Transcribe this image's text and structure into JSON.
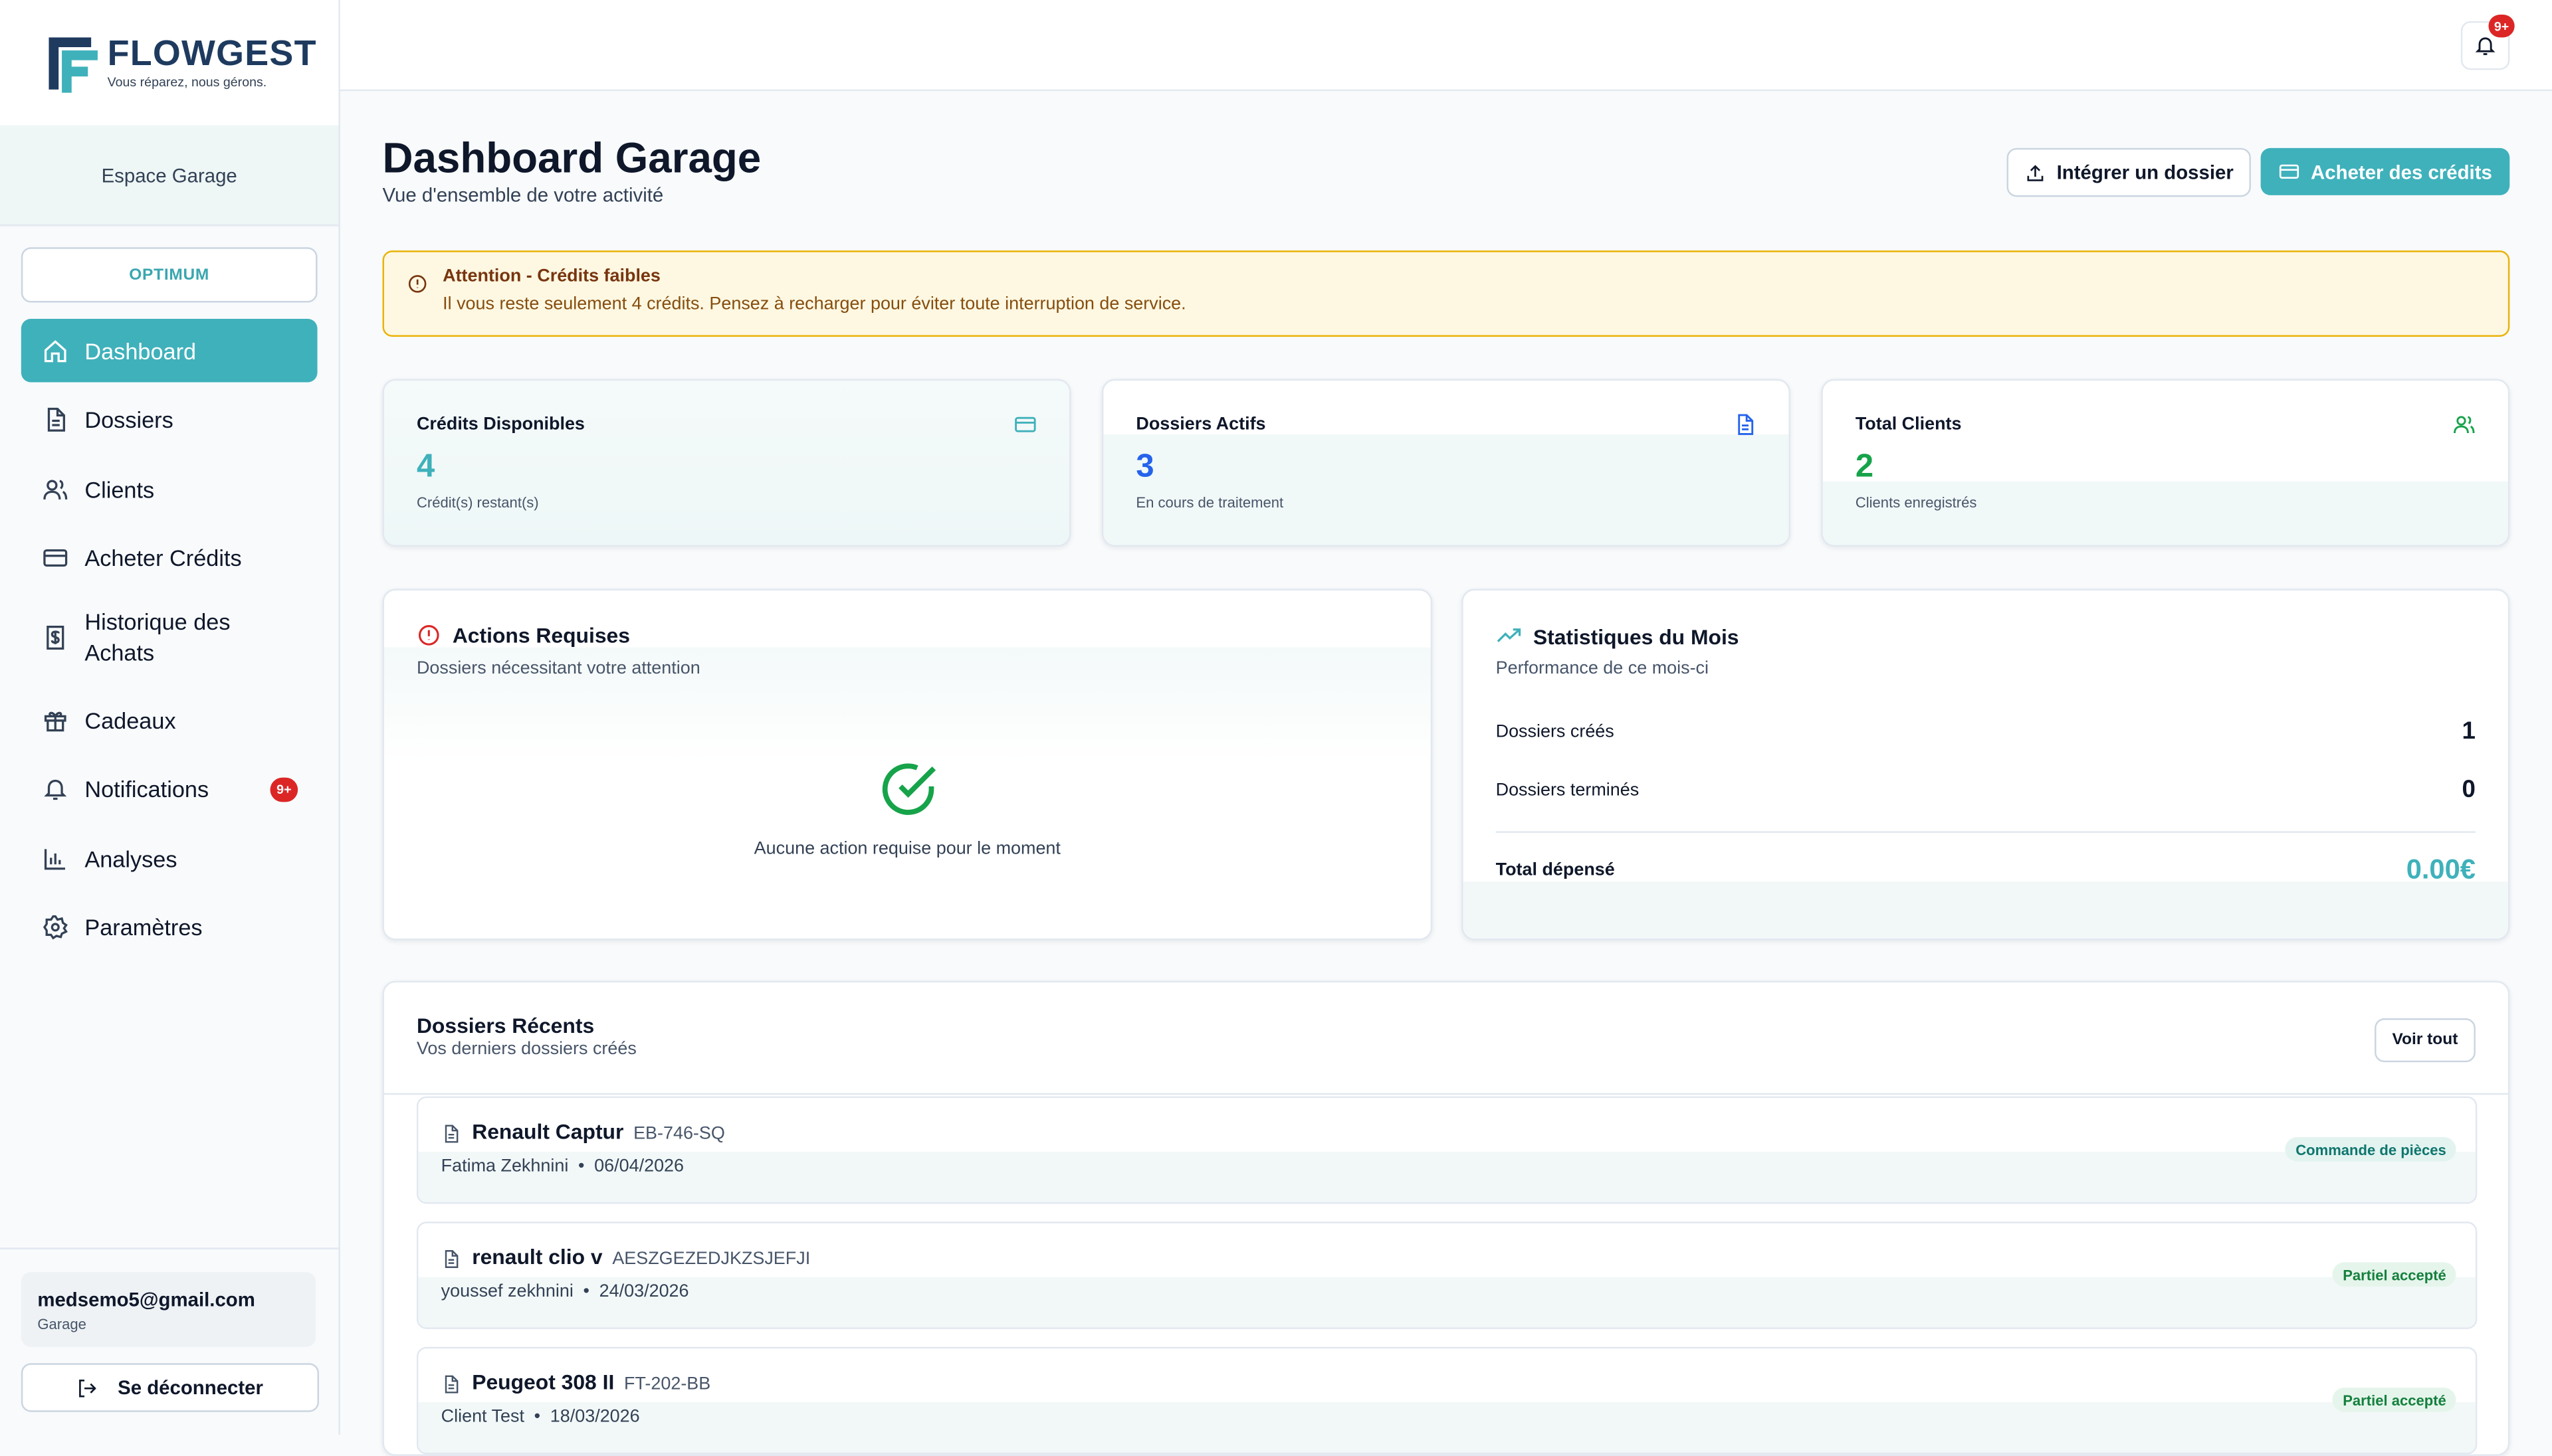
{
  "brand": {
    "name": "FLOWGEST",
    "tagline": "Vous réparez, nous gérons."
  },
  "sidebar": {
    "space_label": "Espace Garage",
    "plan": "OPTIMUM",
    "items": [
      {
        "label": "Dashboard",
        "icon": "home-icon"
      },
      {
        "label": "Dossiers",
        "icon": "file-icon"
      },
      {
        "label": "Clients",
        "icon": "users-icon"
      },
      {
        "label": "Acheter Crédits",
        "icon": "credit-card-icon"
      },
      {
        "label": "Historique des Achats",
        "icon": "receipt-icon"
      },
      {
        "label": "Cadeaux",
        "icon": "gift-icon"
      },
      {
        "label": "Notifications",
        "icon": "bell-icon",
        "badge": "9+"
      },
      {
        "label": "Analyses",
        "icon": "bar-chart-icon"
      },
      {
        "label": "Paramètres",
        "icon": "gear-icon"
      }
    ],
    "user": {
      "email": "medsemo5@gmail.com",
      "role": "Garage"
    },
    "logout_label": "Se déconnecter"
  },
  "topbar": {
    "notif_badge": "9+"
  },
  "header": {
    "title": "Dashboard Garage",
    "subtitle": "Vue d'ensemble de votre activité",
    "import_label": "Intégrer un dossier",
    "buy_label": "Acheter des crédits"
  },
  "alert": {
    "title": "Attention - Crédits faibles",
    "text": "Il vous reste seulement 4 crédits. Pensez à recharger pour éviter toute interruption de service."
  },
  "stats": [
    {
      "label": "Crédits Disponibles",
      "value": "4",
      "sub": "Crédit(s) restant(s)",
      "color": "#3fb1bb"
    },
    {
      "label": "Dossiers Actifs",
      "value": "3",
      "sub": "En cours de traitement",
      "color": "#2563eb"
    },
    {
      "label": "Total Clients",
      "value": "2",
      "sub": "Clients enregistrés",
      "color": "#16a34a"
    }
  ],
  "actions": {
    "title": "Actions Requises",
    "subtitle": "Dossiers nécessitant votre attention",
    "empty": "Aucune action requise pour le moment"
  },
  "monthly": {
    "title": "Statistiques du Mois",
    "subtitle": "Performance de ce mois-ci",
    "created_label": "Dossiers créés",
    "created_value": "1",
    "done_label": "Dossiers terminés",
    "done_value": "0",
    "total_label": "Total dépensé",
    "total_value": "0.00€"
  },
  "recent": {
    "title": "Dossiers Récents",
    "subtitle": "Vos derniers dossiers créés",
    "view_all": "Voir tout",
    "rows": [
      {
        "vehicle": "Renault Captur",
        "plate": "EB-746-SQ",
        "client": "Fatima Zekhnini",
        "date": "06/04/2026",
        "status": "Commande de pièces"
      },
      {
        "vehicle": "renault clio v",
        "plate": "AESZGEZEDJKZSJEFJI",
        "client": "youssef zekhnini",
        "date": "24/03/2026",
        "status": "Partiel accepté"
      },
      {
        "vehicle": "Peugeot 308 II",
        "plate": "FT-202-BB",
        "client": "Client Test",
        "date": "18/03/2026",
        "status": "Partiel accepté"
      }
    ]
  }
}
